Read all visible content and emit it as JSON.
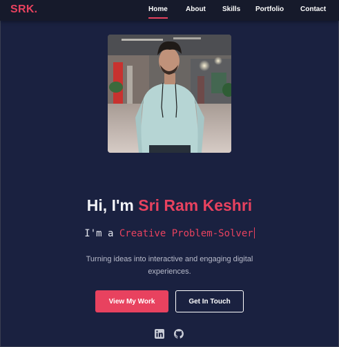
{
  "nav": {
    "logo": "SRK.",
    "links": [
      {
        "label": "Home",
        "active": true
      },
      {
        "label": "About"
      },
      {
        "label": "Skills"
      },
      {
        "label": "Portfolio"
      },
      {
        "label": "Contact"
      }
    ]
  },
  "hero": {
    "greeting": "Hi, I'm",
    "name": "Sri Ram Keshri",
    "typed_prefix": "I'm a",
    "typed_role": "Creative Problem-Solver",
    "tagline": "Turning ideas into interactive and engaging digital experiences.",
    "primary_button": "View My Work",
    "secondary_button": "Get In Touch"
  },
  "social": [
    {
      "icon": "linkedin-icon"
    },
    {
      "icon": "github-icon"
    }
  ],
  "colors": {
    "accent": "#e8425f",
    "background": "#1a2140",
    "nav_background": "#161a2b"
  }
}
